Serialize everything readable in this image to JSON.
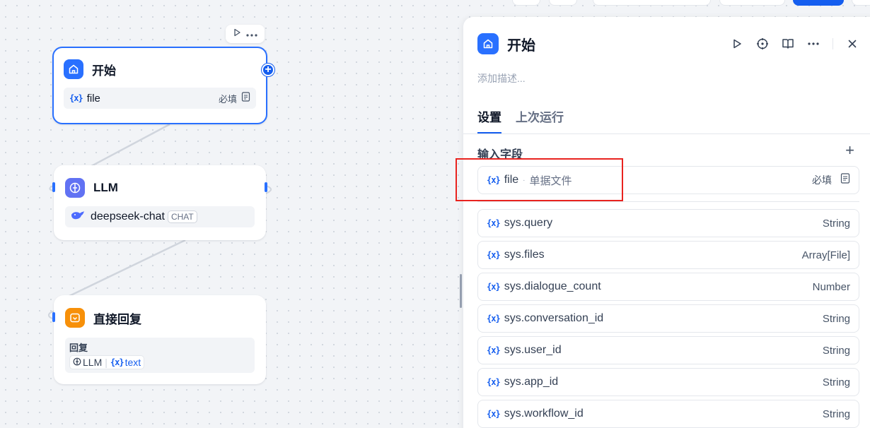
{
  "canvas": {
    "nodes": [
      {
        "id": "start",
        "title": "开始",
        "icon": "home-icon",
        "color": "#2970ff",
        "fields": [
          {
            "name": "file",
            "required_label": "必填"
          }
        ]
      },
      {
        "id": "llm",
        "title": "LLM",
        "icon": "llm-icon",
        "color": "#6172f3",
        "model": {
          "name": "deepseek-chat",
          "mode": "CHAT",
          "icon": "whale-icon"
        }
      },
      {
        "id": "answer",
        "title": "直接回复",
        "icon": "reply-icon",
        "color": "#f79009",
        "reply_label": "回复",
        "reply_refs": {
          "node": "LLM",
          "var": "text"
        }
      }
    ]
  },
  "panel": {
    "title": "开始",
    "description_placeholder": "添加描述...",
    "tabs": [
      {
        "label": "设置",
        "active": true
      },
      {
        "label": "上次运行",
        "active": false
      }
    ],
    "section_title": "输入字段",
    "input_field": {
      "name": "file",
      "desc": "单据文件",
      "required_label": "必填"
    },
    "system_vars": [
      {
        "name": "sys.query",
        "type": "String"
      },
      {
        "name": "sys.files",
        "type": "Array[File]"
      },
      {
        "name": "sys.dialogue_count",
        "type": "Number"
      },
      {
        "name": "sys.conversation_id",
        "type": "String"
      },
      {
        "name": "sys.user_id",
        "type": "String"
      },
      {
        "name": "sys.app_id",
        "type": "String"
      },
      {
        "name": "sys.workflow_id",
        "type": "String"
      }
    ]
  },
  "colors": {
    "accent": "#155eef",
    "highlight_box": "#e8231f"
  }
}
